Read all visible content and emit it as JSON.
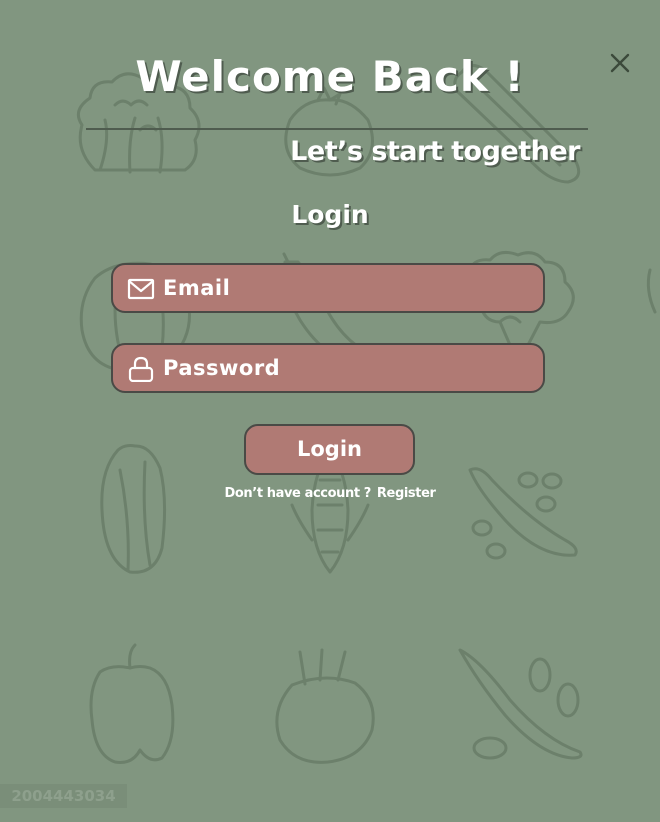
{
  "dialog": {
    "title": "Welcome Back !",
    "subtitle": "Let’s start together",
    "section_heading": "Login",
    "close_icon": "close-icon"
  },
  "form": {
    "email": {
      "placeholder": "Email",
      "value": "",
      "icon": "mail-icon"
    },
    "password": {
      "placeholder": "Password",
      "value": "",
      "icon": "lock-icon"
    },
    "submit_label": "Login",
    "no_account_text": "Don’t have account ?",
    "register_label": "Register"
  },
  "background": {
    "pattern": "vegetable-line-art",
    "icons": [
      "cauliflower-icon",
      "tomato-icon",
      "zucchini-icon",
      "pumpkin-icon",
      "chili-pepper-icon",
      "broccoli-icon",
      "cabbage-icon",
      "corn-icon",
      "pea-pod-icon",
      "bell-pepper-icon",
      "kohlrabi-icon",
      "bean-pod-icon"
    ]
  },
  "watermark": {
    "text": "2004443034"
  },
  "colors": {
    "background": "#819680",
    "accent_fill": "#b07a74",
    "outline": "#4a4a46",
    "text": "#ffffff"
  }
}
